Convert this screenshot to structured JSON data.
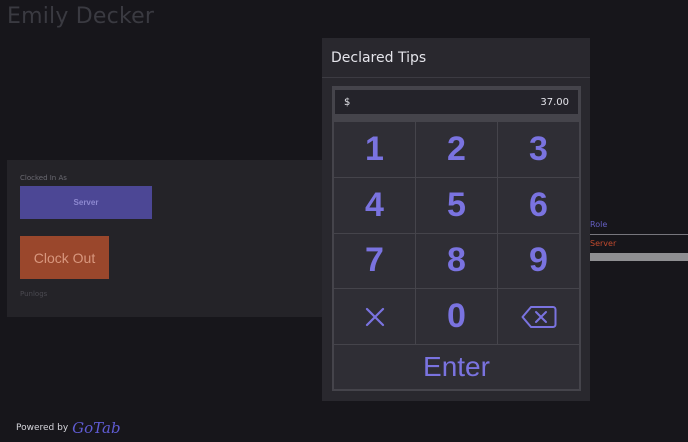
{
  "employee": {
    "name": "Emily Decker"
  },
  "clock": {
    "clocked_in_label": "Clocked In As",
    "role_button": "Server",
    "clock_out_button": "Clock Out",
    "punch_link": "Punlogs"
  },
  "role_table": {
    "header": "Role",
    "value": "Server"
  },
  "footer": {
    "powered_by": "Powered by",
    "logo_text": "GoTab"
  },
  "dialog": {
    "title": "Declared Tips",
    "currency_symbol": "$",
    "amount": "37.00",
    "keys": [
      "1",
      "2",
      "3",
      "4",
      "5",
      "6",
      "7",
      "8",
      "9"
    ],
    "clear_icon": "x-icon",
    "zero": "0",
    "backspace_icon": "backspace-icon",
    "enter_label": "Enter"
  },
  "colors": {
    "accent": "#7a73e0",
    "role_button": "#4c4795",
    "clock_out": "#9a472c",
    "server_text": "#c14a2e"
  }
}
